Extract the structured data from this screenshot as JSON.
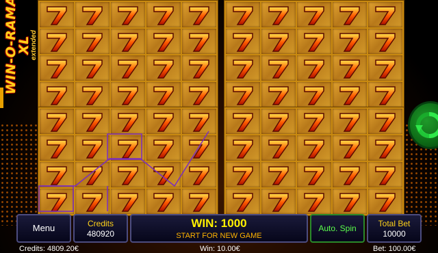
{
  "logo": {
    "main": "WIN-O-RAMA XL",
    "sub": "extended"
  },
  "buttons": {
    "menu": "Menu",
    "credits_label": "Credits",
    "credits_value": "480920",
    "win_label": "WIN: 1000",
    "win_sub": "START FOR NEW GAME",
    "auto_spin": "Auto. Spin",
    "bet_label": "Total Bet",
    "bet_value": "10000"
  },
  "status": {
    "credits": "Credits: 4809.20€",
    "win": "Win: 10.00€",
    "bet": "Bet: 100.00€"
  },
  "symbol": "seven-icon",
  "colors": {
    "accent": "#ffd21a",
    "spin": "#1f9a2a",
    "win_text": "#fff000"
  }
}
